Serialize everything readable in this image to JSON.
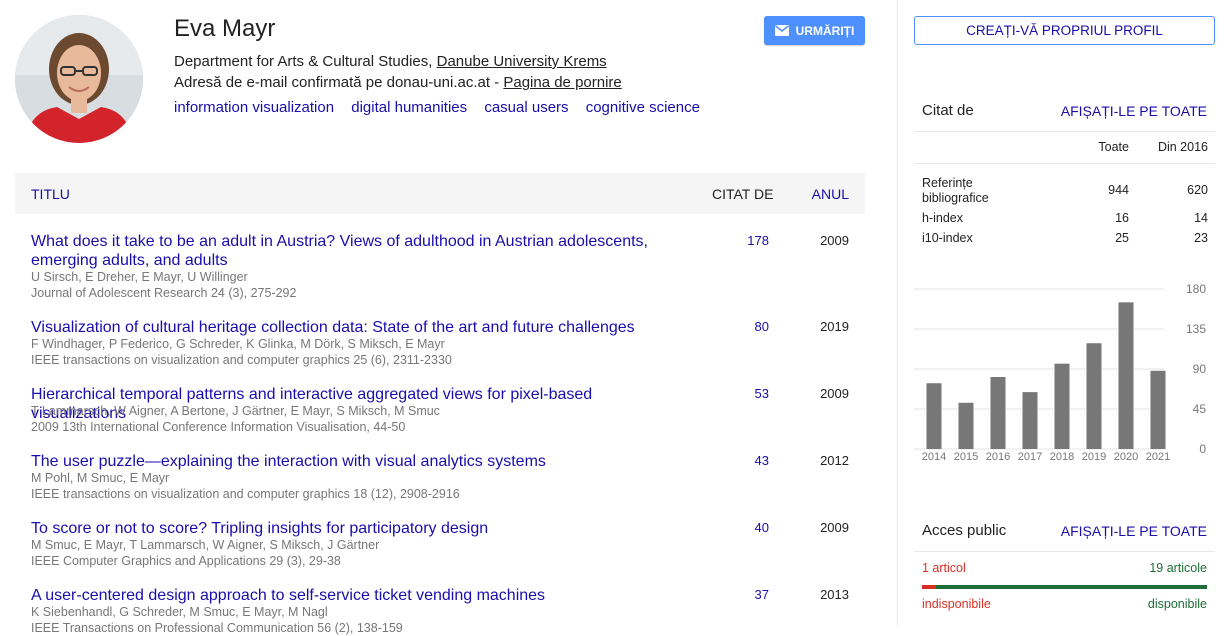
{
  "profile": {
    "name": "Eva Mayr",
    "affiliation_prefix": "Department for Arts & Cultural Studies, ",
    "affiliation_link": "Danube University Krems",
    "email_text": "Adresă de e-mail confirmată pe donau-uni.ac.at - ",
    "homepage_link": "Pagina de pornire",
    "interests": [
      "information visualization",
      "digital humanities",
      "casual users",
      "cognitive science"
    ]
  },
  "follow_button": {
    "label": "URMĂRIȚI",
    "icon": "envelope-icon"
  },
  "create_profile_button": {
    "label": "CREAȚI-VĂ PROPRIUL PROFIL"
  },
  "table": {
    "headers": {
      "title": "TITLU",
      "cited": "CITAT DE",
      "year": "ANUL"
    },
    "rows": [
      {
        "title": "What does it take to be an adult in Austria? Views of adulthood in Austrian adolescents, emerging adults, and adults",
        "authors": "U Sirsch, E Dreher, E Mayr, U Willinger",
        "venue": "Journal of Adolescent Research 24 (3), 275-292",
        "cited": "178",
        "year": "2009"
      },
      {
        "title": "Visualization of cultural heritage collection data: State of the art and future challenges",
        "authors": "F Windhager, P Federico, G Schreder, K Glinka, M Dörk, S Miksch, E Mayr",
        "venue": "IEEE transactions on visualization and computer graphics 25 (6), 2311-2330",
        "cited": "80",
        "year": "2019"
      },
      {
        "title": "Hierarchical temporal patterns and interactive aggregated views for pixel-based visualizations",
        "authors": "T Lammarsch, W Aigner, A Bertone, J Gärtner, E Mayr, S Miksch, M Smuc",
        "venue": "2009 13th International Conference Information Visualisation, 44-50",
        "cited": "53",
        "year": "2009"
      },
      {
        "title": "The user puzzle—explaining the interaction with visual analytics systems",
        "authors": "M Pohl, M Smuc, E Mayr",
        "venue": "IEEE transactions on visualization and computer graphics 18 (12), 2908-2916",
        "cited": "43",
        "year": "2012"
      },
      {
        "title": "To score or not to score? Tripling insights for participatory design",
        "authors": "M Smuc, E Mayr, T Lammarsch, W Aigner, S Miksch, J Gärtner",
        "venue": "IEEE Computer Graphics and Applications 29 (3), 29-38",
        "cited": "40",
        "year": "2009"
      },
      {
        "title": "A user-centered design approach to self-service ticket vending machines",
        "authors": "K Siebenhandl, G Schreder, M Smuc, E Mayr, M Nagl",
        "venue": "IEEE Transactions on Professional Communication 56 (2), 138-159",
        "cited": "37",
        "year": "2013"
      }
    ]
  },
  "cited_by": {
    "title": "Citat de",
    "show_all": "AFIȘAȚI-LE PE TOATE",
    "col_all": "Toate",
    "col_since": "Din 2016",
    "rows": [
      {
        "label": "Referințe bibliografice",
        "all": "944",
        "since": "620"
      },
      {
        "label": "h-index",
        "all": "16",
        "since": "14"
      },
      {
        "label": "i10-index",
        "all": "25",
        "since": "23"
      }
    ]
  },
  "chart_data": {
    "type": "bar",
    "categories": [
      "2014",
      "2015",
      "2016",
      "2017",
      "2018",
      "2019",
      "2020",
      "2021"
    ],
    "values": [
      74,
      52,
      81,
      64,
      96,
      119,
      165,
      88
    ],
    "ylim": [
      0,
      180
    ],
    "yticks": [
      "180",
      "135",
      "90",
      "45",
      "0"
    ],
    "bar_color": "#777777"
  },
  "public_access": {
    "title": "Acces public",
    "show_all": "AFIȘAȚI-LE PE TOATE",
    "unavailable_count": "1 articol",
    "available_count": "19 articole",
    "unavailable_label": "indisponibile",
    "available_label": "disponibile",
    "colors": {
      "unavailable": "#d93025",
      "available": "#1e6e37"
    }
  }
}
